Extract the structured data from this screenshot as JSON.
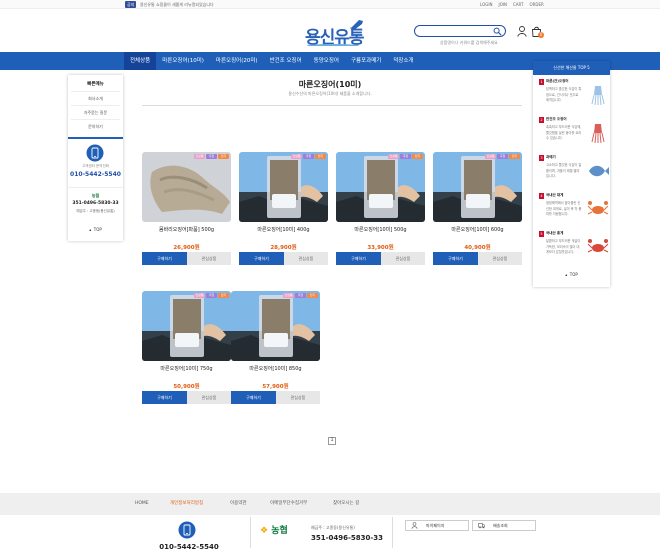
{
  "topbar": {
    "notice_badge": "공지",
    "notice_text": "용신유통 쇼핑몰이 새롭게 리뉴얼되었습니다",
    "links": [
      "LOGIN",
      "JOIN",
      "CART",
      "ORDER"
    ]
  },
  "logo": {
    "text": "용신유통"
  },
  "search": {
    "placeholder": "",
    "hint": "상품명이나 키워드를 검색해주세요"
  },
  "header": {
    "cart_count": "0"
  },
  "nav": {
    "items": [
      "전체상품",
      "마른오징어(10미)",
      "마른오징어(20미)",
      "반건조 오징어",
      "동양오징어",
      "구룡포과메기",
      "덕장소개"
    ]
  },
  "left_sidebar": {
    "title": "빠른메뉴",
    "menu": [
      "회사소개",
      "자주묻는 질문",
      "문의하기"
    ],
    "phone_label": "고객센터 문의전화",
    "phone": "010-5442-5540",
    "bank_name": "농협",
    "bank_account": "351-0496-5830-33",
    "bank_holder": "예금주 : 고종동(용신유통)",
    "top": "TOP"
  },
  "main": {
    "title": "마른오징어(10미)",
    "subtitle": "용신수산의 마른오징어(10미) 제품을 소개합니다."
  },
  "products": [
    {
      "name": "몸바리오징어[파품] 500g",
      "price": "26,900원",
      "buy": "구매하기",
      "cart": "관심상품"
    },
    {
      "name": "마른오징어[10미] 400g",
      "price": "28,900원",
      "buy": "구매하기",
      "cart": "관심상품"
    },
    {
      "name": "마른오징어[10미] 500g",
      "price": "33,900원",
      "buy": "구매하기",
      "cart": "관심상품"
    },
    {
      "name": "마른오징어[10미] 600g",
      "price": "40,900원",
      "buy": "구매하기",
      "cart": "관심상품"
    },
    {
      "name": "마른오징어[10미] 750g",
      "price": "50,900원",
      "buy": "구매하기",
      "cart": "관심상품"
    },
    {
      "name": "마른오징어[10미] 850g",
      "price": "57,900원",
      "buy": "구매하기",
      "cart": "관심상품"
    }
  ],
  "badges": [
    "신상품",
    "추천",
    "인기"
  ],
  "pagination": {
    "current": "1"
  },
  "right_sidebar": {
    "title": "신선한 해산물 TOP 5",
    "items": [
      {
        "num": "1",
        "name": "마른(건)오징어",
        "desc": "담백하고 졸깃한 식감이 특징으로, 간식이나 안주로 제격입니다.",
        "icon": "squid-icon"
      },
      {
        "num": "2",
        "name": "반건조 오징어",
        "desc": "촉촉하고 부드러운 식감에, 쫄깃함을 살린 동이를 요리 수 있습니다.",
        "icon": "squid-icon"
      },
      {
        "num": "3",
        "name": "과메기",
        "desc": "고소하고 쫄깃한 식감이 일품이며, 겨울이 제철 별미입니다.",
        "icon": "fish-icon"
      },
      {
        "num": "4",
        "name": "국내산 대게",
        "desc": "청정해역에서 잡아올린 신선한 대게로, 살이 꽉 차 풍미를 자랑합니다.",
        "icon": "crab-icon"
      },
      {
        "num": "5",
        "name": "국내산 홍게",
        "desc": "달콤하고 부드러운 게살이 가득한, 보리속이 많아 대게보다 감칠맛입니다.",
        "icon": "crab-icon"
      }
    ],
    "top": "TOP"
  },
  "footer_nav": [
    "HOME",
    "개인정보처리방침",
    "이용약관",
    "이메일무단수집거부",
    "찾아오시는 길"
  ],
  "footer": {
    "phone": "010-5442-5540",
    "bank_name": "농협",
    "bank_holder": "예금주 : 고종동(용신유통)",
    "bank_account": "351-0496-5830-33",
    "btn_mypage": "마이페이지",
    "btn_delivery": "배송조회"
  },
  "colors": {
    "primary": "#1f5fb8",
    "price": "#e25b12",
    "badge_new": "#e8a0c8",
    "badge_rec": "#9b7fd9",
    "badge_hot": "#f08a4a"
  }
}
